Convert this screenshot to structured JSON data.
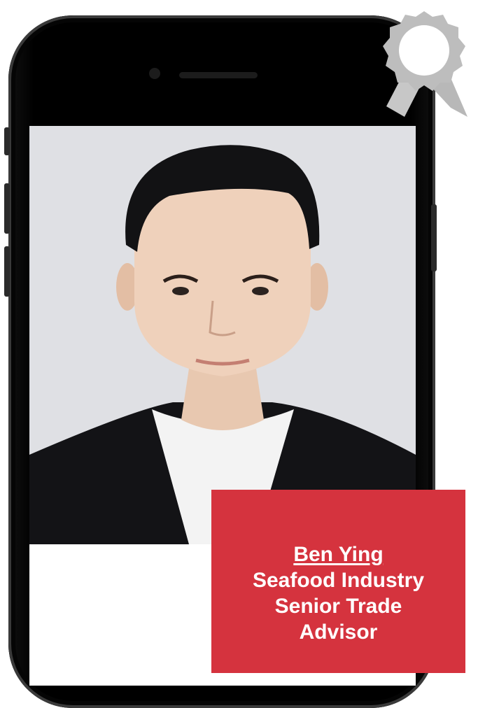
{
  "profile": {
    "name": "Ben Ying",
    "title_lines": [
      "Seafood Industry",
      "Senior Trade",
      "Advisor"
    ]
  },
  "colors": {
    "card_background": "#d5333e",
    "card_text": "#ffffff",
    "phone_body": "#000000",
    "photo_background": "#dfe0e4",
    "badge": "#bdbdbd"
  },
  "icons": {
    "award": "award-ribbon-icon"
  }
}
